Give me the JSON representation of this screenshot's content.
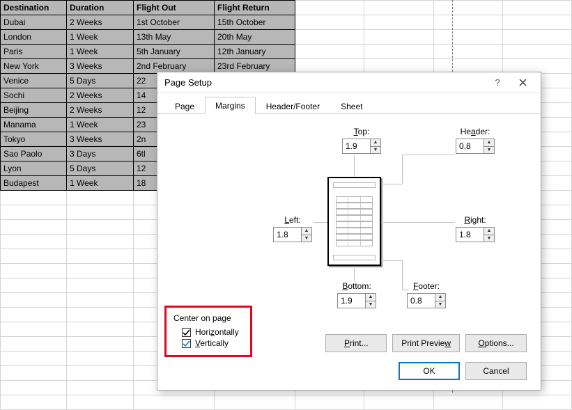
{
  "table": {
    "headers": [
      "Destination",
      "Duration",
      "Flight Out",
      "Flight Return"
    ],
    "rows": [
      [
        "Dubai",
        "2 Weeks",
        "1st October",
        "15th October"
      ],
      [
        "London",
        "1 Week",
        "13th May",
        "20th May"
      ],
      [
        "Paris",
        "1 Week",
        "5th January",
        "12th January"
      ],
      [
        "New York",
        "3 Weeks",
        "2nd February",
        "23rd February"
      ],
      [
        "Venice",
        "5 Days",
        "22",
        ""
      ],
      [
        "Sochi",
        "2 Weeks",
        "14",
        ""
      ],
      [
        "Beijing",
        "2 Weeks",
        "12",
        ""
      ],
      [
        "Manama",
        "1 Week",
        "23",
        ""
      ],
      [
        "Tokyo",
        "3 Weeks",
        "2n",
        ""
      ],
      [
        "Sao Paolo",
        "3 Days",
        "6tl",
        ""
      ],
      [
        "Lyon",
        "5 Days",
        "12",
        ""
      ],
      [
        "Budapest",
        "1 Week",
        "18",
        ""
      ]
    ]
  },
  "dialog": {
    "title": "Page Setup",
    "help": "?",
    "tabs": {
      "page": "Page",
      "margins": "Margins",
      "header_footer": "Header/Footer",
      "sheet": "Sheet"
    },
    "margins": {
      "top_label": "Top:",
      "top_value": "1.9",
      "header_label": "Header:",
      "header_value": "0.8",
      "left_label": "Left:",
      "left_value": "1.8",
      "right_label": "Right:",
      "right_value": "1.8",
      "bottom_label": "Bottom:",
      "bottom_value": "1.9",
      "footer_label": "Footer:",
      "footer_value": "0.8"
    },
    "center_group": {
      "label": "Center on page",
      "horizontally_label": "Horizontally",
      "horizontally_checked": true,
      "vertically_label": "Vertically",
      "vertically_checked": true
    },
    "buttons": {
      "print": "Print...",
      "print_preview": "Print Preview",
      "options": "Options...",
      "ok": "OK",
      "cancel": "Cancel"
    }
  }
}
